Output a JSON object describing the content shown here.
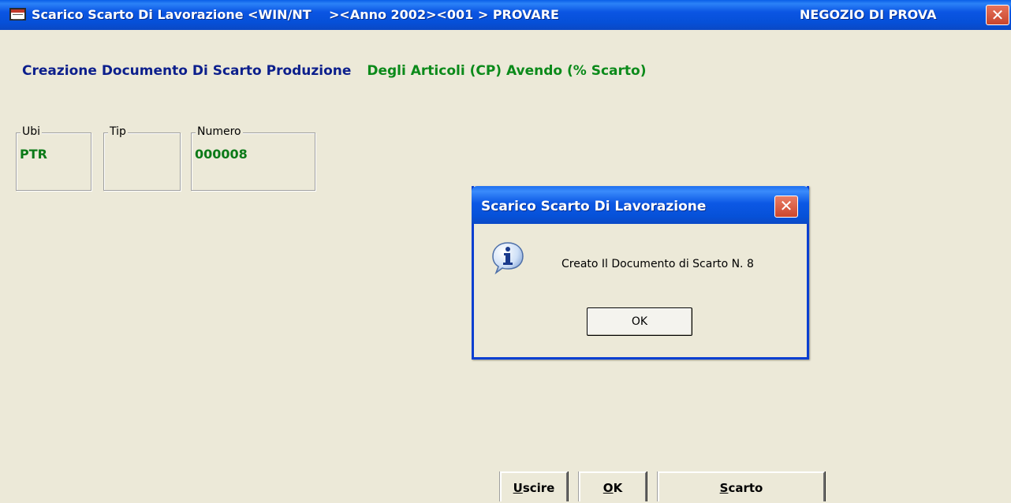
{
  "window": {
    "title": "Scarico Scarto Di Lavorazione <WIN/NT    ><Anno 2002><001 > PROVARE",
    "store_name": "NEGOZIO DI PROVA",
    "close_glyph": "✕"
  },
  "headline": {
    "part1": "Creazione Documento Di Scarto Produzione",
    "part2": "Degli Articoli (CP) Avendo (% Scarto)"
  },
  "fields": {
    "ubi": {
      "label": "Ubi",
      "value": "PTR"
    },
    "tip": {
      "label": "Tip",
      "value": ""
    },
    "numero": {
      "label": "Numero",
      "value": "000008"
    }
  },
  "dialog": {
    "title": "Scarico Scarto Di Lavorazione",
    "message": "Creato Il Documento di Scarto N. 8",
    "ok_label": "OK",
    "close_glyph": "✕",
    "icon": "info-icon"
  },
  "buttons": {
    "uscire": {
      "accel": "U",
      "rest": "scire"
    },
    "ok": {
      "accel": "O",
      "rest": "K"
    },
    "scarto": {
      "accel": "S",
      "rest": "carto"
    }
  },
  "colors": {
    "titlebar": "#0b55e3",
    "background": "#ece9d8",
    "headline_blue": "#0c1f8c",
    "headline_green": "#0b8a1a",
    "value_green": "#0b7a18",
    "close_red": "#c8452c"
  }
}
